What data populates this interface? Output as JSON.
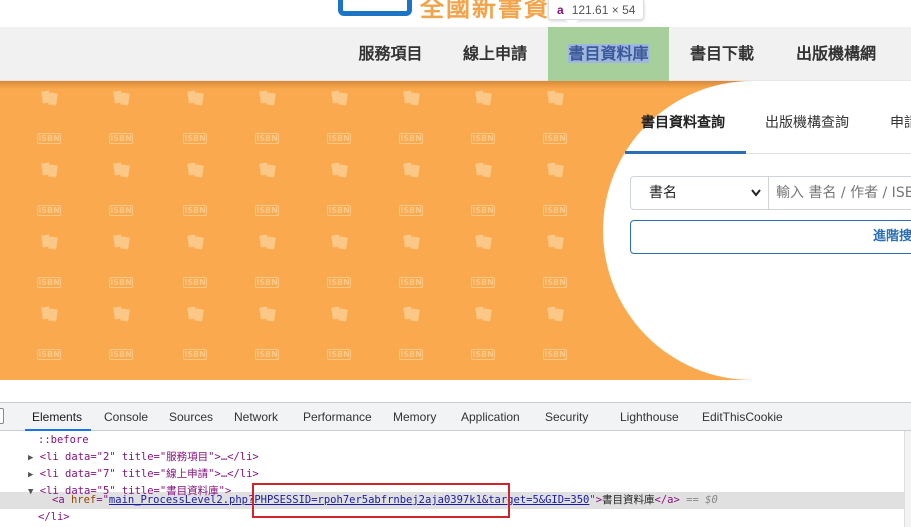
{
  "inspector_tooltip": {
    "tag": "a",
    "dims": "121.61 × 54"
  },
  "nav": {
    "items": [
      {
        "label": "服務項目"
      },
      {
        "label": "線上申請"
      },
      {
        "label": "書目資料庫"
      },
      {
        "label": "書目下載"
      },
      {
        "label": "出版機構網"
      }
    ],
    "active_index": 2
  },
  "search": {
    "tabs": [
      {
        "label": "書目資料查詢"
      },
      {
        "label": "出版機構查詢"
      },
      {
        "label": "申請"
      }
    ],
    "select_value": "書名",
    "input_placeholder": "輸入 書名 / 作者 / ISBN",
    "advanced_label": "進階搜尋"
  },
  "devtools": {
    "tabs": [
      "Elements",
      "Console",
      "Sources",
      "Network",
      "Performance",
      "Memory",
      "Application",
      "Security",
      "Lighthouse",
      "EditThisCookie"
    ],
    "active_tab": "Elements",
    "code": {
      "before": "::before",
      "li2_open": "<li data=\"2\" title=\"服務項目\">",
      "li7_open": "<li data=\"7\" title=\"線上申請\">",
      "li5_open": "<li data=\"5\" title=\"書目資料庫\">",
      "ellipsis_close": "…</li>",
      "a_href_prefix": "main_ProcessLevel2.php",
      "a_href_query": "?PHPSESSID=rpoh7er5abfrnbej2aja0397k1&",
      "a_href_suffix": "target=5&GID=350",
      "a_text": "書目資料庫",
      "a_tail": "== $0",
      "li_close": "</li>"
    }
  },
  "colors": {
    "hero": "#fba94f",
    "nav_active": "#a6cf9b",
    "accent": "#2a6fb5",
    "highlight_box": "#d0262b"
  },
  "icons": [
    "expand-triangle-icon",
    "collapse-triangle-icon",
    "select-chevron-icon"
  ]
}
